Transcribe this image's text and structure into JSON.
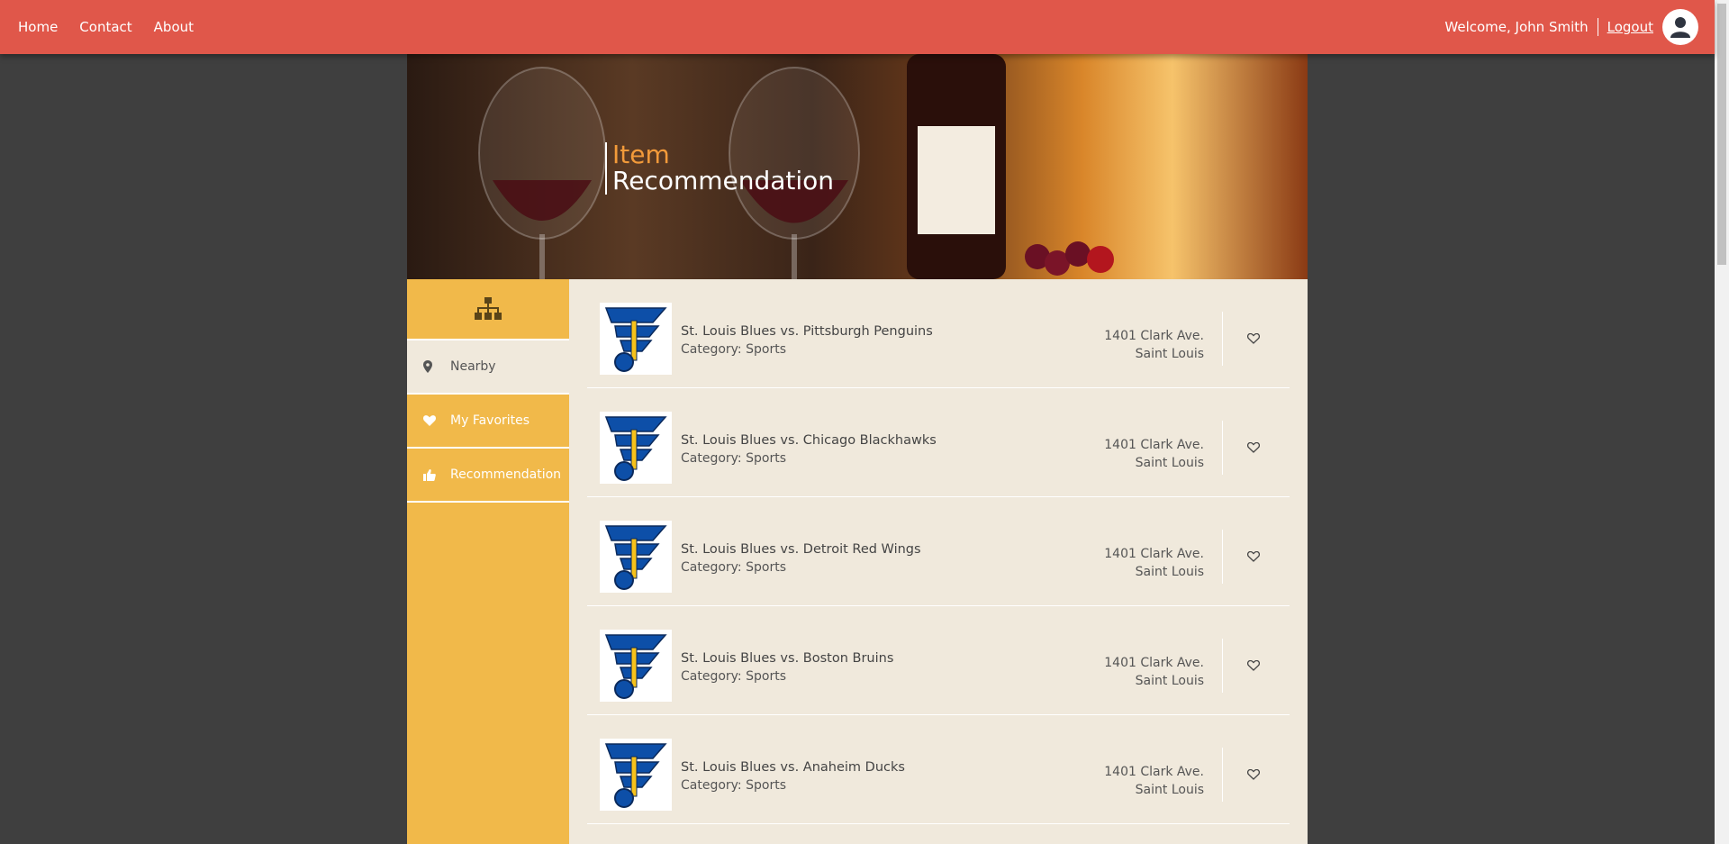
{
  "nav": {
    "links": [
      "Home",
      "Contact",
      "About"
    ],
    "welcome": "Welcome, John Smith",
    "logout": "Logout"
  },
  "hero": {
    "line1": "Item",
    "line2": "Recommendation"
  },
  "sidebar": {
    "header_icon": "sitemap-icon",
    "items": [
      {
        "label": "Nearby",
        "icon": "map-pin-icon",
        "active": true
      },
      {
        "label": "My Favorites",
        "icon": "heart-icon",
        "active": false
      },
      {
        "label": "Recommendation",
        "icon": "thumbs-up-icon",
        "active": false
      }
    ]
  },
  "items": [
    {
      "title": "St. Louis Blues vs. Pittsburgh Penguins",
      "category_label": "Category:",
      "category": "Sports",
      "address1": "1401 Clark Ave.",
      "address2": "Saint Louis"
    },
    {
      "title": "St. Louis Blues vs. Chicago Blackhawks",
      "category_label": "Category:",
      "category": "Sports",
      "address1": "1401 Clark Ave.",
      "address2": "Saint Louis"
    },
    {
      "title": "St. Louis Blues vs. Detroit Red Wings",
      "category_label": "Category:",
      "category": "Sports",
      "address1": "1401 Clark Ave.",
      "address2": "Saint Louis"
    },
    {
      "title": "St. Louis Blues vs. Boston Bruins",
      "category_label": "Category:",
      "category": "Sports",
      "address1": "1401 Clark Ave.",
      "address2": "Saint Louis"
    },
    {
      "title": "St. Louis Blues vs. Anaheim Ducks",
      "category_label": "Category:",
      "category": "Sports",
      "address1": "1401 Clark Ave.",
      "address2": "Saint Louis"
    }
  ],
  "colors": {
    "nav": "#e0574a",
    "sidebar": "#f1b94a",
    "main_bg": "#f0e9dc",
    "title_accent": "#f29a3a"
  }
}
